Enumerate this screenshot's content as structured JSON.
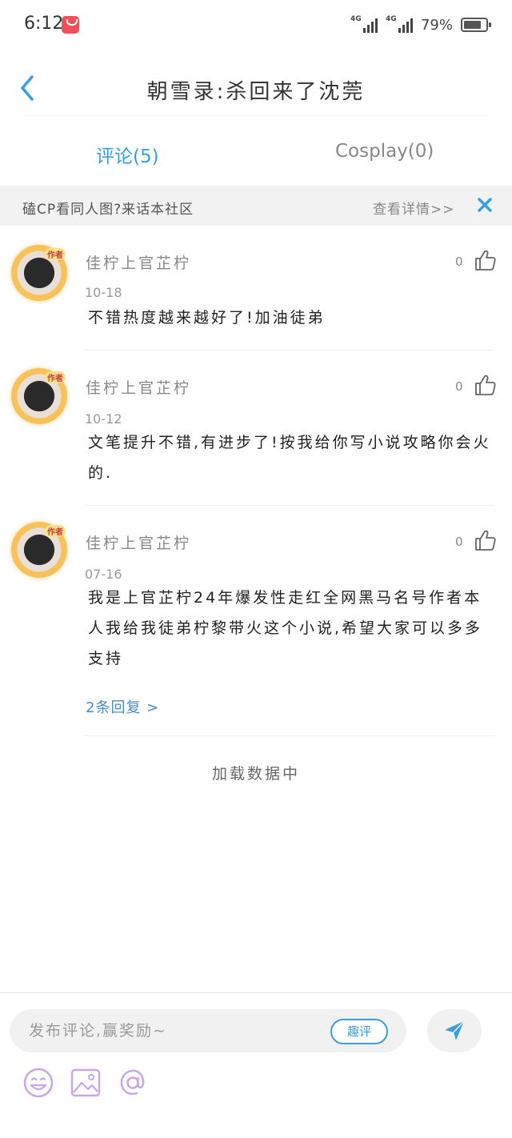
{
  "status_bar": {
    "time": "6:12",
    "network_1": "4G",
    "network_2": "4G",
    "battery_percent": "79%",
    "battery_level": 0.79
  },
  "header": {
    "title": "朝雪录:杀回来了沈莞",
    "back_icon": "chevron-left-icon"
  },
  "tabs": [
    {
      "label": "评论(5)",
      "active": true
    },
    {
      "label": "Cosplay(0)",
      "active": false
    }
  ],
  "banner": {
    "text": "磕CP看同人图?来话本社区",
    "link_label": "查看详情>>",
    "close_icon": "close-icon"
  },
  "comments": [
    {
      "user": "佳柠上官芷柠",
      "likes": "0",
      "date": "10-18",
      "text": "不错热度越来越好了!加油徒弟"
    },
    {
      "user": "佳柠上官芷柠",
      "likes": "0",
      "date": "10-12",
      "text": "文笔提升不错,有进步了!按我给你写小说攻略你会火的."
    },
    {
      "user": "佳柠上官芷柠",
      "likes": "0",
      "date": "07-16",
      "text": "我是上官芷柠24年爆发性走红全网黑马名号作者本人我给我徒弟柠黎带火这个小说,希望大家可以多多支持",
      "replies": "2条回复 >"
    }
  ],
  "loading_text": "加载数据中",
  "composer": {
    "placeholder": "发布评论,赢奖励~",
    "quping_label": "趣评",
    "send_icon": "send-icon",
    "tools": [
      "emoji-icon",
      "image-icon",
      "at-icon"
    ]
  },
  "colors": {
    "accent": "#3a9fe0",
    "link": "#4a8cc8",
    "tool_icon": "#c9a6e6"
  }
}
